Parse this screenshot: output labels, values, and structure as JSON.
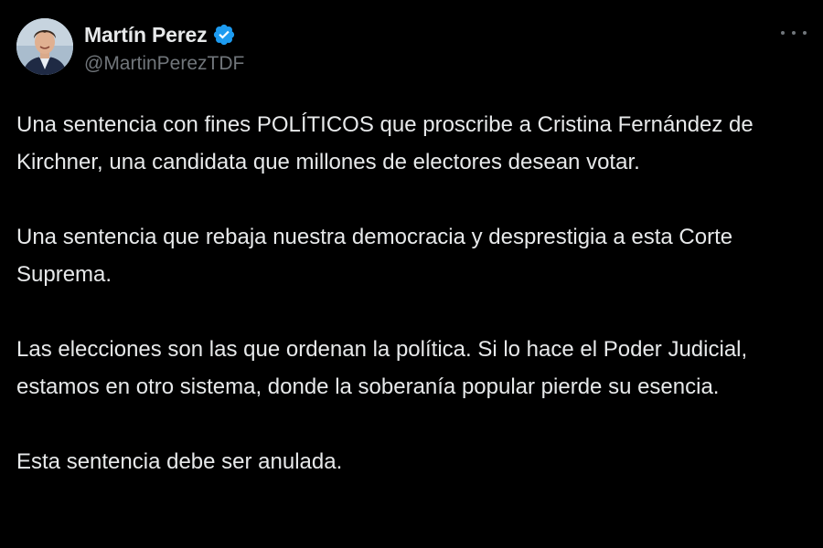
{
  "theme": {
    "background": "#000000",
    "text": "#e7e9ea",
    "muted": "#71767b",
    "verified_blue": "#1d9bf0"
  },
  "author": {
    "name": "Martín Perez",
    "handle": "@MartinPerezTDF",
    "verified": true,
    "avatar_icon": "profile-photo"
  },
  "menu": {
    "icon": "more-options-icon"
  },
  "tweet": {
    "paragraphs": [
      "Una sentencia con fines POLÍTICOS que proscribe a Cristina Fernández de Kirchner, una candidata que millones de electores desean votar.",
      "Una sentencia que rebaja nuestra democracia y desprestigia a esta Corte Suprema.",
      "Las elecciones son las que ordenan la política. Si lo hace el Poder Judicial, estamos en otro sistema, donde la soberanía popular pierde su esencia.",
      "Esta sentencia debe ser anulada."
    ]
  }
}
